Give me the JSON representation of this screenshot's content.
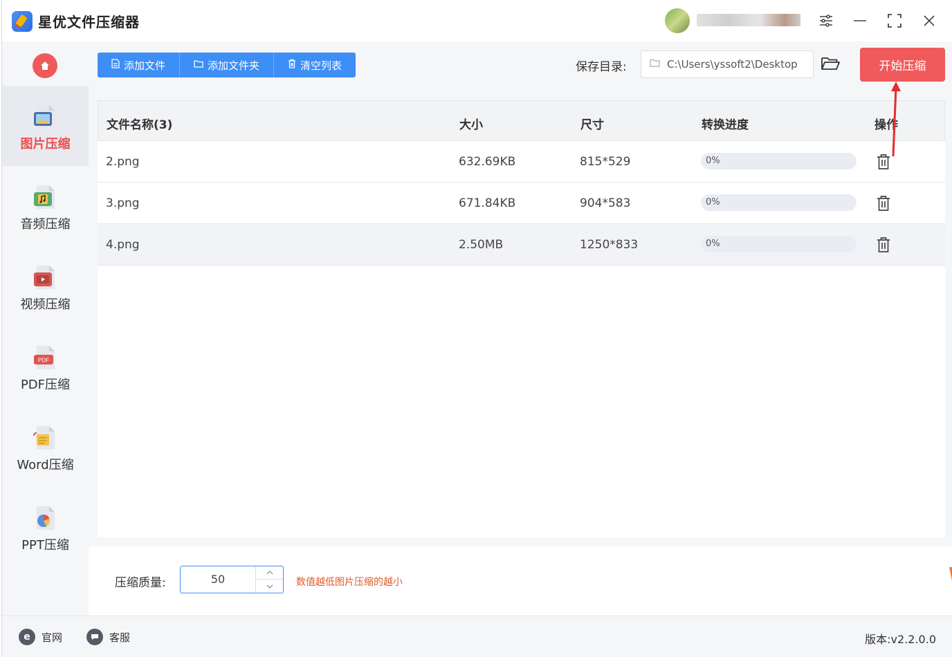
{
  "app": {
    "title": "星优文件压缩器"
  },
  "titlebar": {
    "icons": [
      "settings-sliders-icon",
      "minimize-icon",
      "maximize-icon",
      "close-icon"
    ]
  },
  "sidebar": {
    "items": [
      {
        "label": "图片压缩",
        "icon": "image-file-icon",
        "active": true
      },
      {
        "label": "音频压缩",
        "icon": "audio-file-icon",
        "active": false
      },
      {
        "label": "视频压缩",
        "icon": "video-file-icon",
        "active": false
      },
      {
        "label": "PDF压缩",
        "icon": "pdf-file-icon",
        "active": false
      },
      {
        "label": "Word压缩",
        "icon": "word-file-icon",
        "active": false
      },
      {
        "label": "PPT压缩",
        "icon": "ppt-file-icon",
        "active": false
      }
    ]
  },
  "toolbar": {
    "add_file": "添加文件",
    "add_folder": "添加文件夹",
    "clear_list": "清空列表",
    "save_dir_label": "保存目录:",
    "save_dir_value": "C:\\Users\\yssoft2\\Desktop",
    "start_button": "开始压缩"
  },
  "table": {
    "headers": {
      "name": "文件名称(3)",
      "size": "大小",
      "dimensions": "尺寸",
      "progress": "转换进度",
      "action": "操作"
    },
    "rows": [
      {
        "name": "2.png",
        "size": "632.69KB",
        "dimensions": "815*529",
        "progress_text": "0%",
        "progress": 0
      },
      {
        "name": "3.png",
        "size": "671.84KB",
        "dimensions": "904*583",
        "progress_text": "0%",
        "progress": 0
      },
      {
        "name": "4.png",
        "size": "2.50MB",
        "dimensions": "1250*833",
        "progress_text": "0%",
        "progress": 0
      }
    ]
  },
  "quality": {
    "label": "压缩质量:",
    "value": "50",
    "hint": "数值越低图片压缩的越小"
  },
  "footer": {
    "website": "官网",
    "support": "客服",
    "version": "版本:v2.2.0.0"
  },
  "colors": {
    "accent_blue": "#3d8ef5",
    "accent_red": "#f05a5a",
    "hint_orange": "#e05a2a"
  }
}
